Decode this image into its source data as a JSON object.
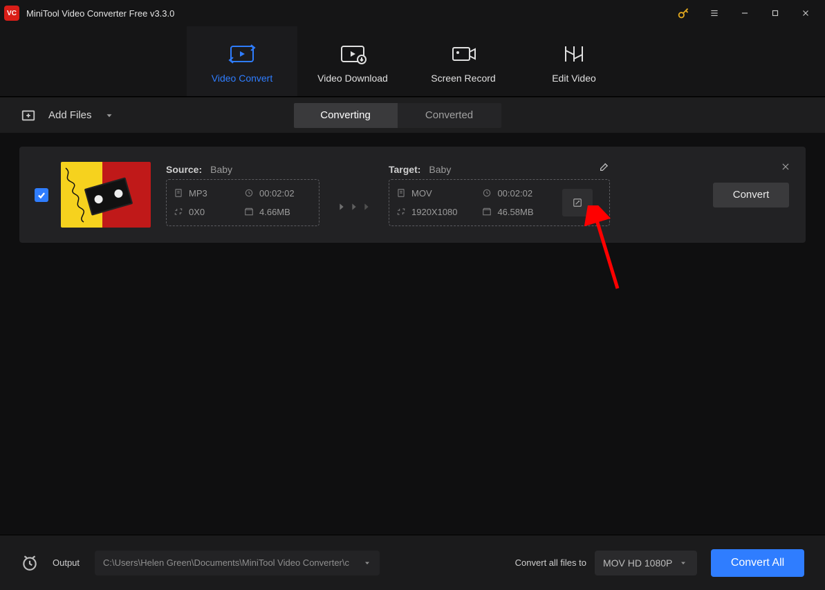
{
  "title": "MiniTool Video Converter Free v3.3.0",
  "logo_text": "VC",
  "nav": {
    "items": [
      {
        "label": "Video Convert"
      },
      {
        "label": "Video Download"
      },
      {
        "label": "Screen Record"
      },
      {
        "label": "Edit Video"
      }
    ]
  },
  "toolbar": {
    "add_files": "Add Files",
    "seg_converting": "Converting",
    "seg_converted": "Converted"
  },
  "item": {
    "source_label": "Source:",
    "source_name": "Baby",
    "target_label": "Target:",
    "target_name": "Baby",
    "src": {
      "format": "MP3",
      "duration": "00:02:02",
      "resolution": "0X0",
      "size": "4.66MB"
    },
    "tgt": {
      "format": "MOV",
      "duration": "00:02:02",
      "resolution": "1920X1080",
      "size": "46.58MB"
    },
    "convert_label": "Convert"
  },
  "footer": {
    "output_label": "Output",
    "output_path": "C:\\Users\\Helen Green\\Documents\\MiniTool Video Converter\\c",
    "all_label": "Convert all files to",
    "format": "MOV HD 1080P",
    "convert_all": "Convert All"
  }
}
